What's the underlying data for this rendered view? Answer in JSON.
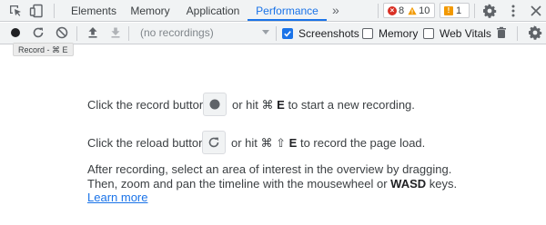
{
  "tabs": [
    {
      "label": "Elements"
    },
    {
      "label": "Memory"
    },
    {
      "label": "Application"
    },
    {
      "label": "Performance"
    }
  ],
  "more_tabs_glyph": "»",
  "counters": {
    "errors": "8",
    "warnings": "10",
    "issues": "1"
  },
  "toolbar": {
    "recordings_placeholder": "(no recordings)",
    "screenshots_label": "Screenshots",
    "screenshots_checked": true,
    "memory_label": "Memory",
    "memory_checked": false,
    "web_vitals_label": "Web Vitals",
    "web_vitals_checked": false
  },
  "tooltip": "Record - ⌘ E",
  "landing": {
    "record_prefix": "Click the record button",
    "record_shortcut_prefix": "or hit ⌘",
    "record_key": "E",
    "record_suffix": "to start a new recording.",
    "reload_prefix": "Click the reload button",
    "reload_shortcut_prefix": "or hit ⌘ ⇧",
    "reload_key": "E",
    "reload_suffix": "to record the page load.",
    "paragraph_part1": "After recording, select an area of interest in the overview by dragging. Then, zoom and pan the timeline with the mousewheel or",
    "paragraph_bold": "WASD",
    "paragraph_part2": "keys.",
    "learn_more": "Learn more"
  },
  "colors": {
    "accent": "#1a73e8",
    "error": "#d93025",
    "warning": "#f29900",
    "toolbar_bg": "#f1f3f4"
  },
  "icons": [
    "inspect-element-icon",
    "device-toolbar-icon",
    "gear-icon",
    "more-vert-icon",
    "record-icon",
    "reload-icon",
    "clear-icon",
    "upload-icon",
    "download-icon",
    "trash-icon"
  ]
}
